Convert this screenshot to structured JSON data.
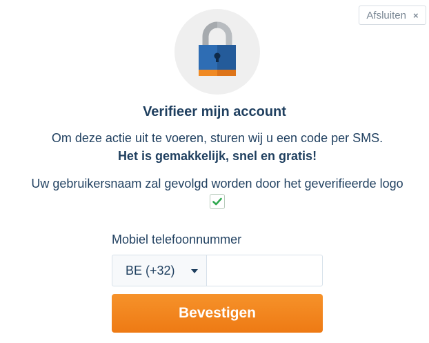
{
  "header": {
    "close_label": "Afsluiten",
    "close_icon": "×"
  },
  "hero": {
    "icon": "padlock-icon",
    "colors": {
      "lock_body": "#2e6db4",
      "lock_base": "#f08a24",
      "shackle": "#b8bcc0",
      "circle_bg": "#efefef"
    }
  },
  "content": {
    "title": "Verifieer mijn account",
    "description": "Om deze actie uit te voeren, sturen wij u een code per SMS.",
    "highlight": "Het is gemakkelijk, snel en gratis!",
    "logo_note": "Uw gebruikersnaam zal gevolgd worden door het geverifieerde logo",
    "verified_icon": "checkmark-icon",
    "verified_color": "#2fa84f"
  },
  "form": {
    "phone_label": "Mobiel telefoonnummer",
    "country_selected": "BE (+32)",
    "phone_value": "",
    "submit_label": "Bevestigen",
    "accent_color": "#f08a24"
  }
}
